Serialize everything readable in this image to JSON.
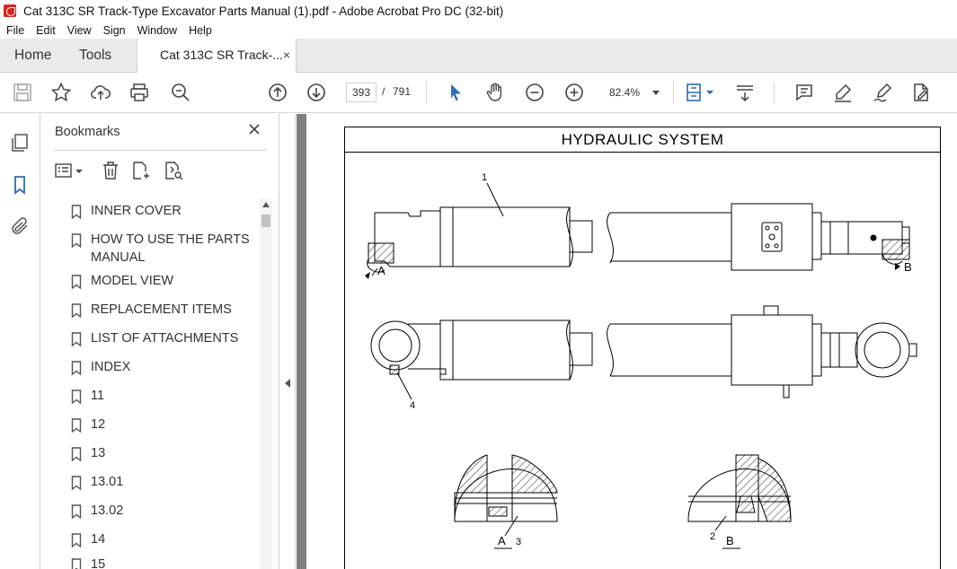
{
  "window": {
    "title": "Cat 313C SR Track-Type Excavator Parts Manual (1).pdf - Adobe Acrobat Pro DC (32-bit)"
  },
  "menu": [
    "File",
    "Edit",
    "View",
    "Sign",
    "Window",
    "Help"
  ],
  "tabs": {
    "home": "Home",
    "tools": "Tools",
    "document": "Cat 313C SR Track-...",
    "close": "×"
  },
  "toolbar": {
    "page_current": "393",
    "page_sep": "/",
    "page_total": "791",
    "zoom": "82.4%"
  },
  "bookmarks": {
    "title": "Bookmarks",
    "items": [
      "INNER COVER",
      "HOW TO USE THE PARTS MANUAL",
      "MODEL VIEW",
      "REPLACEMENT ITEMS",
      "LIST OF ATTACHMENTS",
      "INDEX",
      "11",
      "12",
      "13",
      "13.01",
      "13.02",
      "14",
      "15"
    ]
  },
  "document": {
    "header": "HYDRAULIC   SYSTEM",
    "callouts": {
      "c1": "1",
      "c2": "2",
      "c3": "3",
      "c4": "4",
      "a1": "A",
      "b1": "B",
      "a2": "A",
      "b2": "B"
    }
  },
  "colors": {
    "accent_blue": "#2a6ebb",
    "bookmark_blue": "#2a6ebb",
    "doc_bg": "#7f7f7f"
  }
}
